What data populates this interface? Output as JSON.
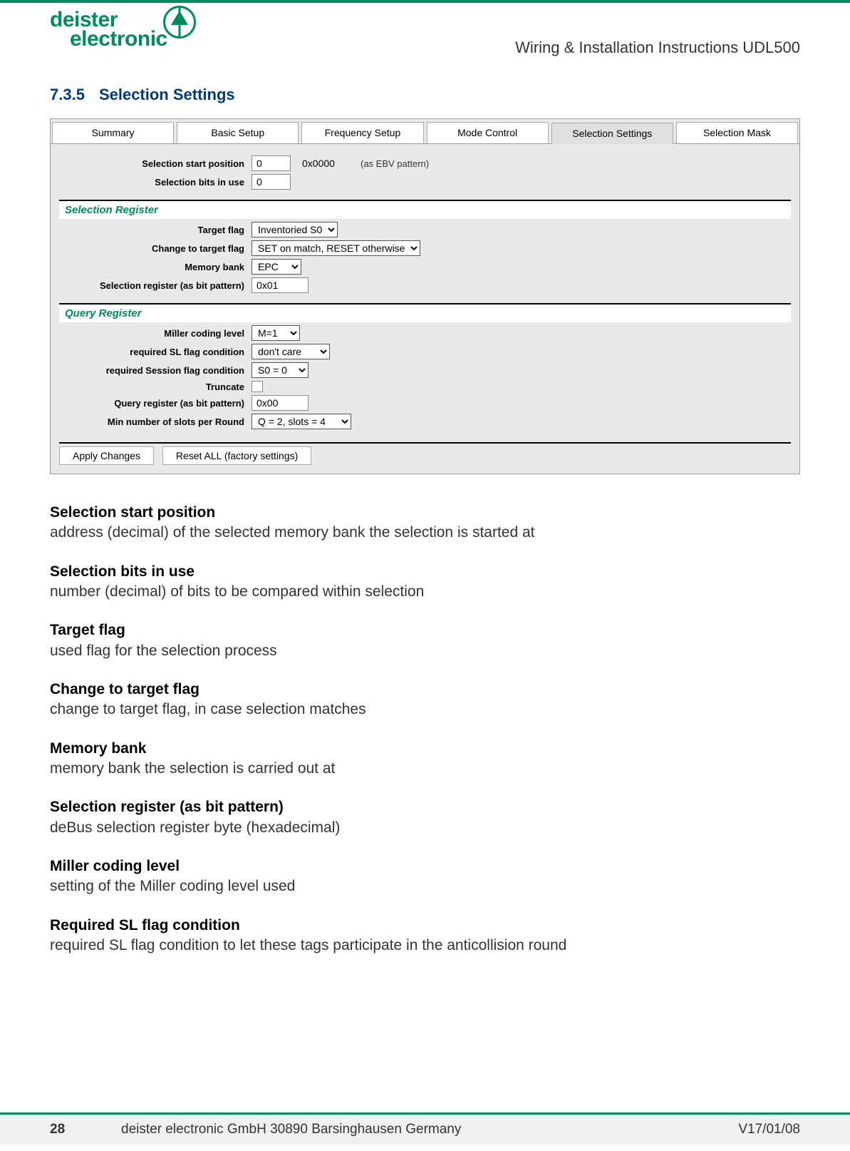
{
  "header": {
    "logo_line1": "deister",
    "logo_line2": "electronic",
    "doc_title": "Wiring & Installation Instructions UDL500"
  },
  "section": {
    "number": "7.3.5",
    "title": "Selection Settings"
  },
  "ui": {
    "tabs": {
      "summary": "Summary",
      "basic_setup": "Basic Setup",
      "frequency_setup": "Frequency Setup",
      "mode_control": "Mode Control",
      "selection_settings": "Selection Settings",
      "selection_mask": "Selection Mask"
    },
    "top": {
      "label_start_pos": "Selection start position",
      "value_start_pos": "0",
      "hex_start_pos": "0x0000",
      "ebv_note": "(as EBV pattern)",
      "label_bits_in_use": "Selection bits in use",
      "value_bits_in_use": "0"
    },
    "selection_register": {
      "title": "Selection Register",
      "label_target_flag": "Target flag",
      "value_target_flag": "Inventoried S0",
      "label_change_flag": "Change to target flag",
      "value_change_flag": "SET on match, RESET otherwise",
      "label_memory_bank": "Memory bank",
      "value_memory_bank": "EPC",
      "label_sel_reg": "Selection register (as bit pattern)",
      "value_sel_reg": "0x01"
    },
    "query_register": {
      "title": "Query Register",
      "label_miller": "Miller coding level",
      "value_miller": "M=1",
      "label_sl_cond": "required SL flag condition",
      "value_sl_cond": "don't care",
      "label_sess_cond": "required Session flag condition",
      "value_sess_cond": "S0 = 0",
      "label_truncate": "Truncate",
      "label_query_reg": "Query register (as bit pattern)",
      "value_query_reg": "0x00",
      "label_min_slots": "Min number of slots per Round",
      "value_min_slots": "Q = 2, slots = 4"
    },
    "buttons": {
      "apply": "Apply Changes",
      "reset": "Reset ALL (factory settings)"
    }
  },
  "definitions": [
    {
      "term": "Selection start position",
      "text": "address (decimal) of the selected memory bank the selection is started at"
    },
    {
      "term": "Selection bits in use",
      "text": "number (decimal) of bits to be compared within selection"
    },
    {
      "term": "Target flag",
      "text": "used flag for the selection process"
    },
    {
      "term": "Change to target flag",
      "text": "change to target flag, in case selection matches"
    },
    {
      "term": "Memory bank",
      "text": "memory bank the selection is carried out at"
    },
    {
      "term": "Selection register (as bit pattern)",
      "text": "deBus selection register byte (hexadecimal)"
    },
    {
      "term": "Miller coding level",
      "text": "setting of the Miller coding level used"
    },
    {
      "term": "Required SL flag condition",
      "text": "required SL flag condition to let these tags participate in the anticollision round"
    }
  ],
  "footer": {
    "page": "28",
    "company": "deister electronic GmbH  30890 Barsinghausen  Germany",
    "version": "V17/01/08"
  }
}
